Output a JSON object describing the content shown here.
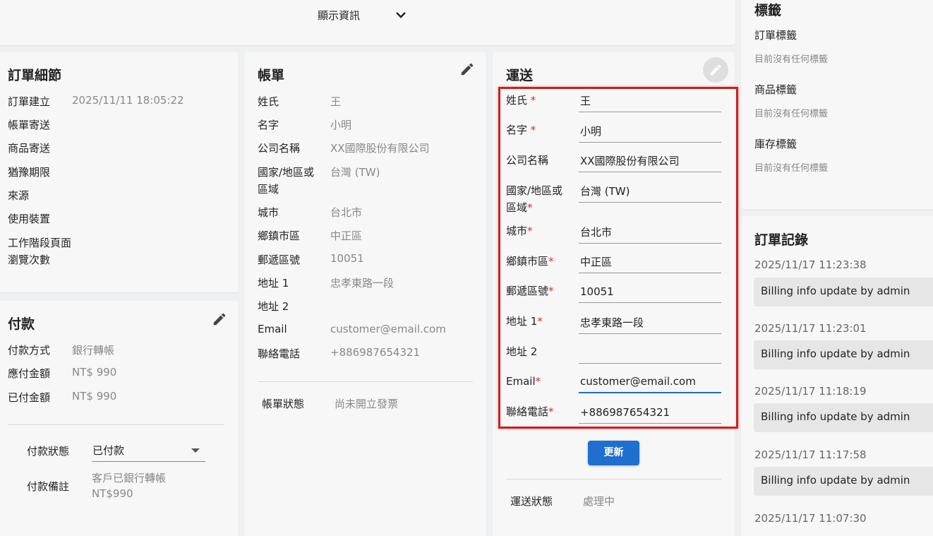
{
  "top_bar": {
    "label": "顯示資訊"
  },
  "order_details": {
    "title": "訂單細節",
    "rows": [
      {
        "label": "訂單建立",
        "value": "2025/11/11 18:05:22"
      },
      {
        "label": "帳單寄送",
        "value": ""
      },
      {
        "label": "商品寄送",
        "value": ""
      },
      {
        "label": "猶豫期限",
        "value": ""
      },
      {
        "label": "來源",
        "value": ""
      },
      {
        "label": "使用裝置",
        "value": ""
      },
      {
        "label": "工作階段頁面",
        "value": ""
      },
      {
        "label": "瀏覽次數",
        "value": ""
      }
    ]
  },
  "payment": {
    "title": "付款",
    "rows": [
      {
        "label": "付款方式",
        "value": "銀行轉帳"
      },
      {
        "label": "應付金額",
        "value": "NT$ 990"
      },
      {
        "label": "已付金額",
        "value": "NT$ 990"
      }
    ],
    "status_label": "付款狀態",
    "status_value": "已付款",
    "note_label": "付款備註",
    "note_line1": "客戶已銀行轉帳",
    "note_line2": "NT$990"
  },
  "billing": {
    "title": "帳單",
    "rows": [
      {
        "label": "姓氏",
        "value": "王"
      },
      {
        "label": "名字",
        "value": "小明"
      },
      {
        "label": "公司名稱",
        "value": "XX國際股份有限公司"
      },
      {
        "label_line1": "國家/地區或",
        "label_line2": "區域",
        "value": "台灣 (TW)"
      },
      {
        "label": "城市",
        "value": "台北市"
      },
      {
        "label": "鄉鎮市區",
        "value": "中正區"
      },
      {
        "label": "郵遞區號",
        "value": "10051"
      },
      {
        "label": "地址 1",
        "value": "忠孝東路一段"
      },
      {
        "label": "地址 2",
        "value": ""
      },
      {
        "label": "Email",
        "value": "customer@email.com"
      },
      {
        "label": "聯絡電話",
        "value": "+886987654321"
      }
    ],
    "invoice_status_label": "帳單狀態",
    "invoice_status_value": "尚未開立發票"
  },
  "shipping": {
    "title": "運送",
    "required_mark": "*",
    "fields": [
      {
        "label": "姓氏",
        "value": "王"
      },
      {
        "label": "名字",
        "value": "小明"
      },
      {
        "label": "公司名稱",
        "value": "XX國際股份有限公司"
      },
      {
        "label_line1": "國家/地區或",
        "label_line2": "區域",
        "value": "台灣 (TW)"
      },
      {
        "label": "城市",
        "value": "台北市"
      },
      {
        "label": "鄉鎮市區",
        "value": "中正區"
      },
      {
        "label": "郵遞區號",
        "value": "10051"
      },
      {
        "label": "地址 1",
        "value": "忠孝東路一段"
      },
      {
        "label": "地址 2",
        "value": ""
      },
      {
        "label": "Email",
        "value": "customer@email.com"
      },
      {
        "label": "聯絡電話",
        "value": "+886987654321"
      }
    ],
    "update_button": "更新",
    "status_label": "運送狀態",
    "status_value": "處理中"
  },
  "tags": {
    "title": "標籤",
    "groups": [
      {
        "label": "訂單標籤",
        "empty": "目前沒有任何標籤"
      },
      {
        "label": "商品標籤",
        "empty": "目前沒有任何標籤"
      },
      {
        "label": "庫存標籤",
        "empty": "目前沒有任何標籤"
      }
    ]
  },
  "order_log": {
    "title": "訂單記錄",
    "entries": [
      {
        "time": "2025/11/17 11:23:38",
        "message": "Billing info update by admin"
      },
      {
        "time": "2025/11/17 11:23:01",
        "message": "Billing info update by admin"
      },
      {
        "time": "2025/11/17 11:18:19",
        "message": "Billing info update by admin"
      },
      {
        "time": "2025/11/17 11:17:58",
        "message": "Billing info update by admin"
      },
      {
        "time": "2025/11/17 11:07:30",
        "message": ""
      }
    ]
  },
  "colors": {
    "accent": "#1e6fd0",
    "required": "#d32f2f",
    "highlight_border": "#cc1f1f"
  }
}
